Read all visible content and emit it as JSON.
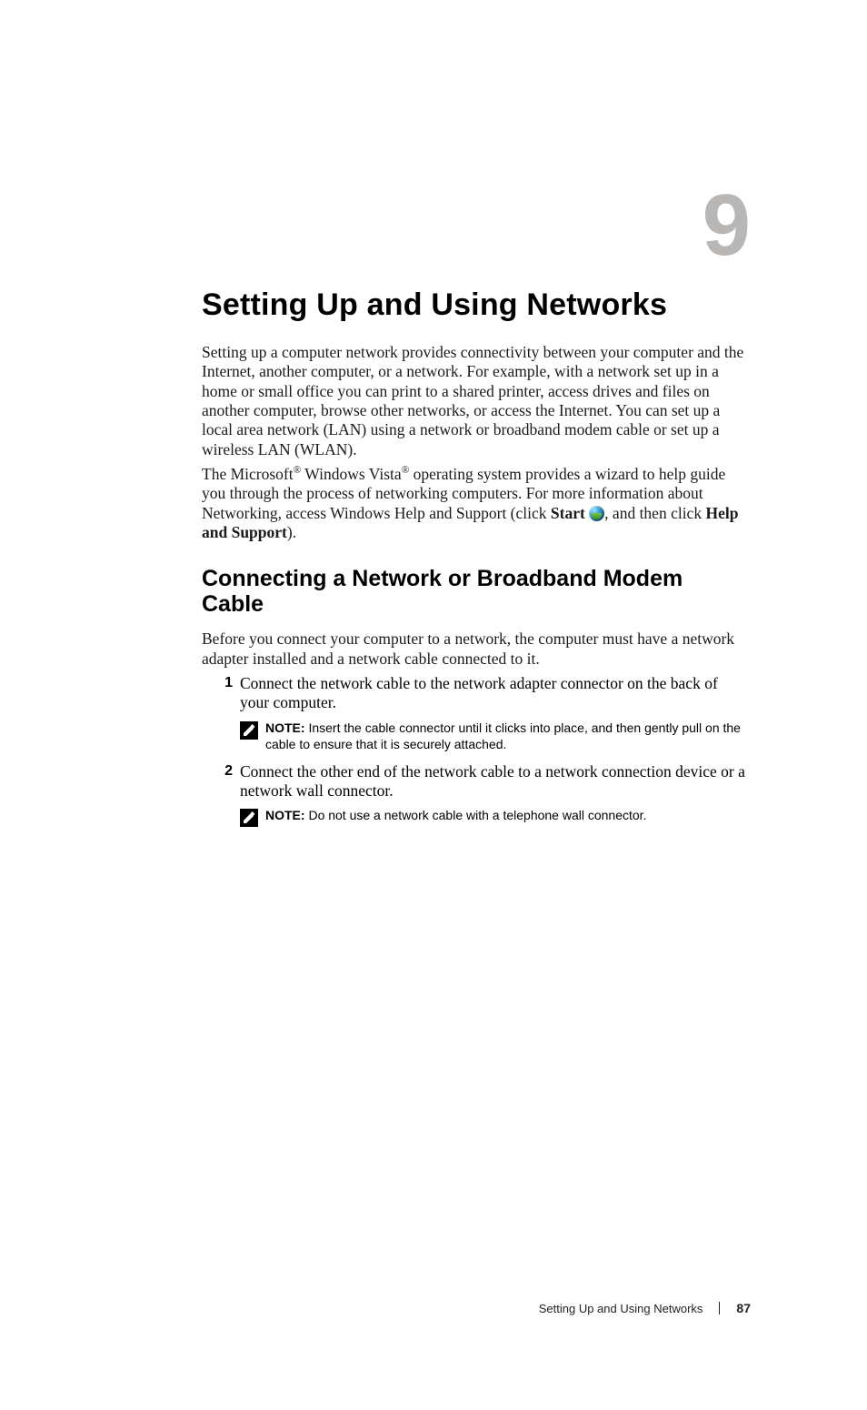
{
  "chapter": {
    "number": "9",
    "title": "Setting Up and Using Networks"
  },
  "intro": {
    "p1": "Setting up a computer network provides connectivity between your computer and the Internet, another computer, or a network. For example, with a network set up in a home or small office you can print to a shared printer, access drives and files on another computer, browse other networks, or access the Internet. You can set up a local area network (LAN) using a network or broadband modem cable or set up a wireless LAN (WLAN).",
    "p2_pre": "The Microsoft",
    "p2_mid": " Windows Vista",
    "p2_post": " operating system provides a wizard to help guide you through the process of networking computers. For more information about Networking, access Windows Help and Support (click ",
    "start_label": "Start",
    "p2_tail_pre": ", and then click ",
    "help_label": "Help and Support",
    "p2_tail_post": ")."
  },
  "section": {
    "title": "Connecting a Network or Broadband Modem Cable",
    "lead": "Before you connect your computer to a network, the computer must have a network adapter installed and a network cable connected to it.",
    "steps": [
      {
        "num": "1",
        "text": "Connect the network cable to the network adapter connector on the back of your computer.",
        "note": "Insert the cable connector until it clicks into place, and then gently pull on the cable to ensure that it is securely attached."
      },
      {
        "num": "2",
        "text": "Connect the other end of the network cable to a network connection device or a network wall connector.",
        "note": "Do not use a network cable with a telephone wall connector."
      }
    ],
    "note_label": "NOTE: "
  },
  "footer": {
    "title": "Setting Up and Using Networks",
    "page": "87"
  }
}
